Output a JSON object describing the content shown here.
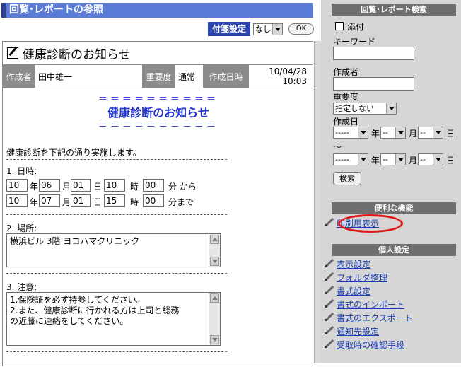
{
  "header": {
    "title": "回覧･レポートの参照"
  },
  "tag_setting": {
    "label": "付箋設定",
    "value": "なし",
    "ok": "OK"
  },
  "document": {
    "title": "健康診断のお知らせ",
    "meta": {
      "author_label": "作成者",
      "author": "田中雄一",
      "priority_label": "重要度",
      "priority": "通常",
      "created_label": "作成日時",
      "date": "10/04/28",
      "time": "10:03"
    },
    "body": {
      "eq_line": "＝＝＝＝＝＝＝＝＝＝",
      "heading": "健康診断のお知らせ",
      "intro": "健康診断を下記の通り実施します。",
      "schedule_label": "1. 日時:",
      "row1": {
        "year": "10",
        "y": "年",
        "month": "06",
        "m": "月",
        "day": "01",
        "d": "日",
        "hour": "10",
        "h": "時",
        "minute": "00",
        "suffix": "分 から"
      },
      "row2": {
        "year": "10",
        "y": "年",
        "month": "07",
        "m": "月",
        "day": "01",
        "d": "日",
        "hour": "15",
        "h": "時",
        "minute": "00",
        "suffix": "分まで"
      },
      "place_label": "2. 場所:",
      "place": "横浜ビル 3階 ヨコハマクリニック",
      "note_label": "3. 注意:",
      "note_line1": "1.保険証を必ず持参してください。",
      "note_line2": "2.また、健康診断に行かれる方は上司と総務",
      "note_line3": "の近藤に連絡をしてください。"
    }
  },
  "search": {
    "title": "回覧･レポート検索",
    "attach_label": "添付",
    "keyword_label": "キーワード",
    "author_label": "作成者",
    "priority_label": "重要度",
    "priority_value": "指定しない",
    "created_label": "作成日",
    "date_blank_year": "-----",
    "date_blank": "--",
    "year": "年",
    "month": "月",
    "day": "日",
    "tilde": "～",
    "search_button": "検索"
  },
  "useful": {
    "title": "便利な機能",
    "print_view": "印刷用表示"
  },
  "personal": {
    "title": "個人設定",
    "items": [
      "表示設定",
      "フォルダ整理",
      "書式設定",
      "書式のインポート",
      "書式のエクスポート",
      "通知先設定",
      "受取時の確認手段"
    ]
  },
  "colors": {
    "accent": "#5a7bd6",
    "link": "#1a3db0",
    "highlight_ring": "#e01818"
  }
}
